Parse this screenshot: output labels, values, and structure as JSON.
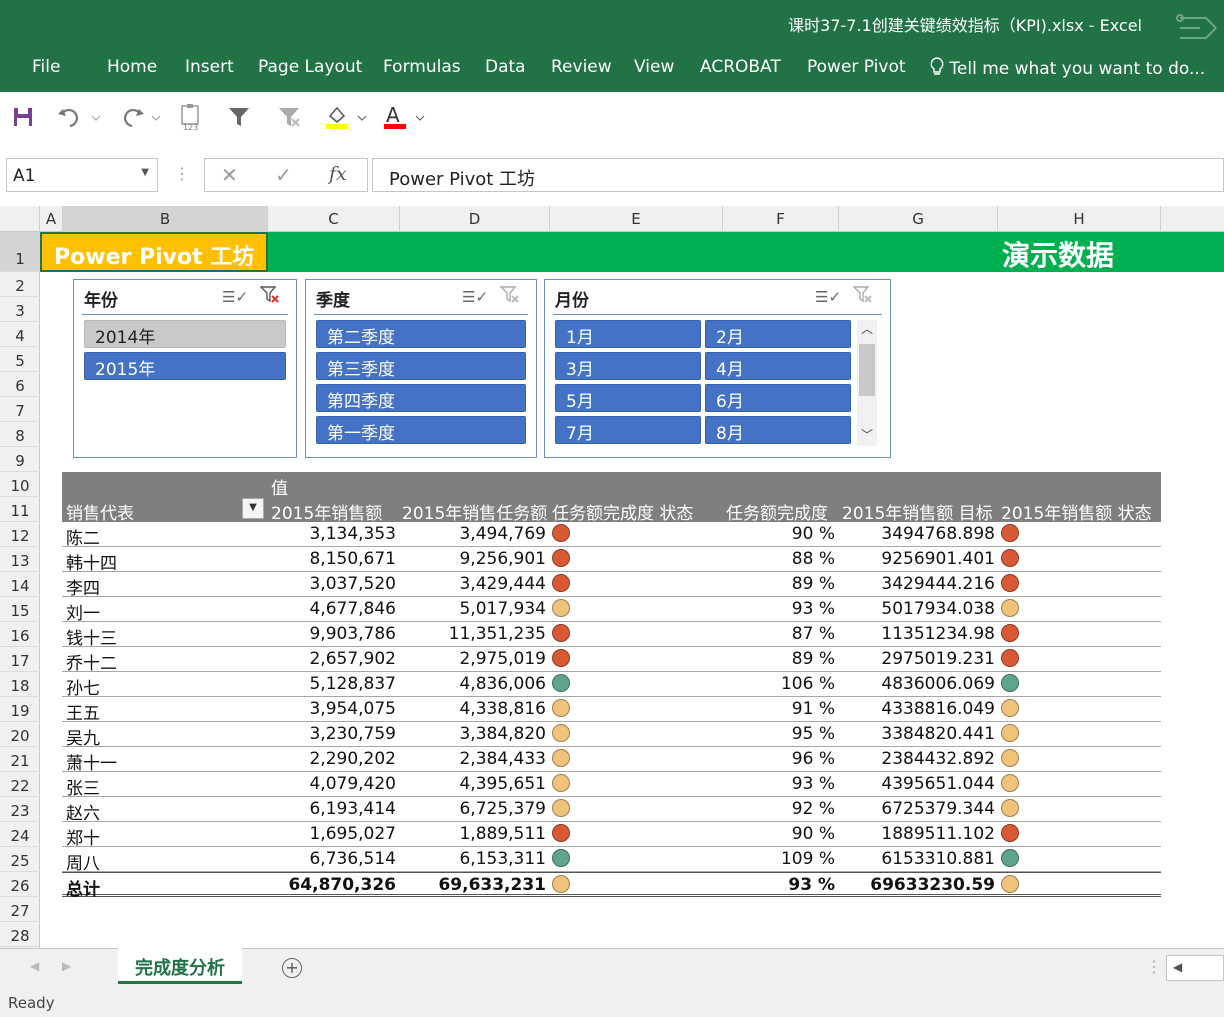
{
  "window": {
    "title": "课时37-7.1创建关键绩效指标（KPI).xlsx - Excel"
  },
  "ribbon": {
    "tabs": [
      "File",
      "Home",
      "Insert",
      "Page Layout",
      "Formulas",
      "Data",
      "Review",
      "View",
      "ACROBAT",
      "Power Pivot"
    ],
    "tell_me": "Tell me what you want to do..."
  },
  "formula_bar": {
    "name_box": "A1",
    "fx": "fx",
    "content": "Power Pivot 工坊"
  },
  "columns": [
    "A",
    "B",
    "C",
    "D",
    "E",
    "F",
    "G",
    "H"
  ],
  "rows": [
    "1",
    "2",
    "3",
    "4",
    "5",
    "6",
    "7",
    "8",
    "9",
    "10",
    "11",
    "12",
    "13",
    "14",
    "15",
    "16",
    "17",
    "18",
    "19",
    "20",
    "21",
    "22",
    "23",
    "24",
    "25",
    "26",
    "27",
    "28"
  ],
  "sheet": {
    "banner_left": "Power Pivot 工坊",
    "banner_right": "演示数据"
  },
  "slicers": {
    "year": {
      "title": "年份",
      "items": [
        {
          "label": "2014年",
          "selected": false
        },
        {
          "label": "2015年",
          "selected": true
        }
      ]
    },
    "quarter": {
      "title": "季度",
      "items": [
        "第二季度",
        "第三季度",
        "第四季度",
        "第一季度"
      ]
    },
    "month": {
      "title": "月份",
      "items": [
        "1月",
        "2月",
        "3月",
        "4月",
        "5月",
        "6月",
        "7月",
        "8月"
      ]
    }
  },
  "pivot": {
    "values_label": "值",
    "row_label": "销售代表",
    "col_c": "2015年销售额",
    "col_d": "2015年销售任务额",
    "col_e": "任务额完成度 状态",
    "col_f": "任务额完成度",
    "col_g": "2015年销售额 目标",
    "col_h": "2015年销售额 状态",
    "rows": [
      {
        "name": "陈二",
        "sales": "3,134,353",
        "target": "3,494,769",
        "pct": "90 %",
        "goal": "3494768.898",
        "status": "red"
      },
      {
        "name": "韩十四",
        "sales": "8,150,671",
        "target": "9,256,901",
        "pct": "88 %",
        "goal": "9256901.401",
        "status": "red"
      },
      {
        "name": "李四",
        "sales": "3,037,520",
        "target": "3,429,444",
        "pct": "89 %",
        "goal": "3429444.216",
        "status": "red"
      },
      {
        "name": "刘一",
        "sales": "4,677,846",
        "target": "5,017,934",
        "pct": "93 %",
        "goal": "5017934.038",
        "status": "yellow"
      },
      {
        "name": "钱十三",
        "sales": "9,903,786",
        "target": "11,351,235",
        "pct": "87 %",
        "goal": "11351234.98",
        "status": "red"
      },
      {
        "name": "乔十二",
        "sales": "2,657,902",
        "target": "2,975,019",
        "pct": "89 %",
        "goal": "2975019.231",
        "status": "red"
      },
      {
        "name": "孙七",
        "sales": "5,128,837",
        "target": "4,836,006",
        "pct": "106 %",
        "goal": "4836006.069",
        "status": "green"
      },
      {
        "name": "王五",
        "sales": "3,954,075",
        "target": "4,338,816",
        "pct": "91 %",
        "goal": "4338816.049",
        "status": "yellow"
      },
      {
        "name": "吴九",
        "sales": "3,230,759",
        "target": "3,384,820",
        "pct": "95 %",
        "goal": "3384820.441",
        "status": "yellow"
      },
      {
        "name": "萧十一",
        "sales": "2,290,202",
        "target": "2,384,433",
        "pct": "96 %",
        "goal": "2384432.892",
        "status": "yellow"
      },
      {
        "name": "张三",
        "sales": "4,079,420",
        "target": "4,395,651",
        "pct": "93 %",
        "goal": "4395651.044",
        "status": "yellow"
      },
      {
        "name": "赵六",
        "sales": "6,193,414",
        "target": "6,725,379",
        "pct": "92 %",
        "goal": "6725379.344",
        "status": "yellow"
      },
      {
        "name": "郑十",
        "sales": "1,695,027",
        "target": "1,889,511",
        "pct": "90 %",
        "goal": "1889511.102",
        "status": "red"
      },
      {
        "name": "周八",
        "sales": "6,736,514",
        "target": "6,153,311",
        "pct": "109 %",
        "goal": "6153310.881",
        "status": "green"
      }
    ],
    "total": {
      "name": "总计",
      "sales": "64,870,326",
      "target": "69,633,231",
      "pct": "93 %",
      "goal": "69633230.59",
      "status": "yellow"
    }
  },
  "status_colors": {
    "red": "#d75a35",
    "yellow": "#f0c27a",
    "green": "#5fa58c"
  },
  "sheet_tab": "完成度分析",
  "status_bar": "Ready"
}
